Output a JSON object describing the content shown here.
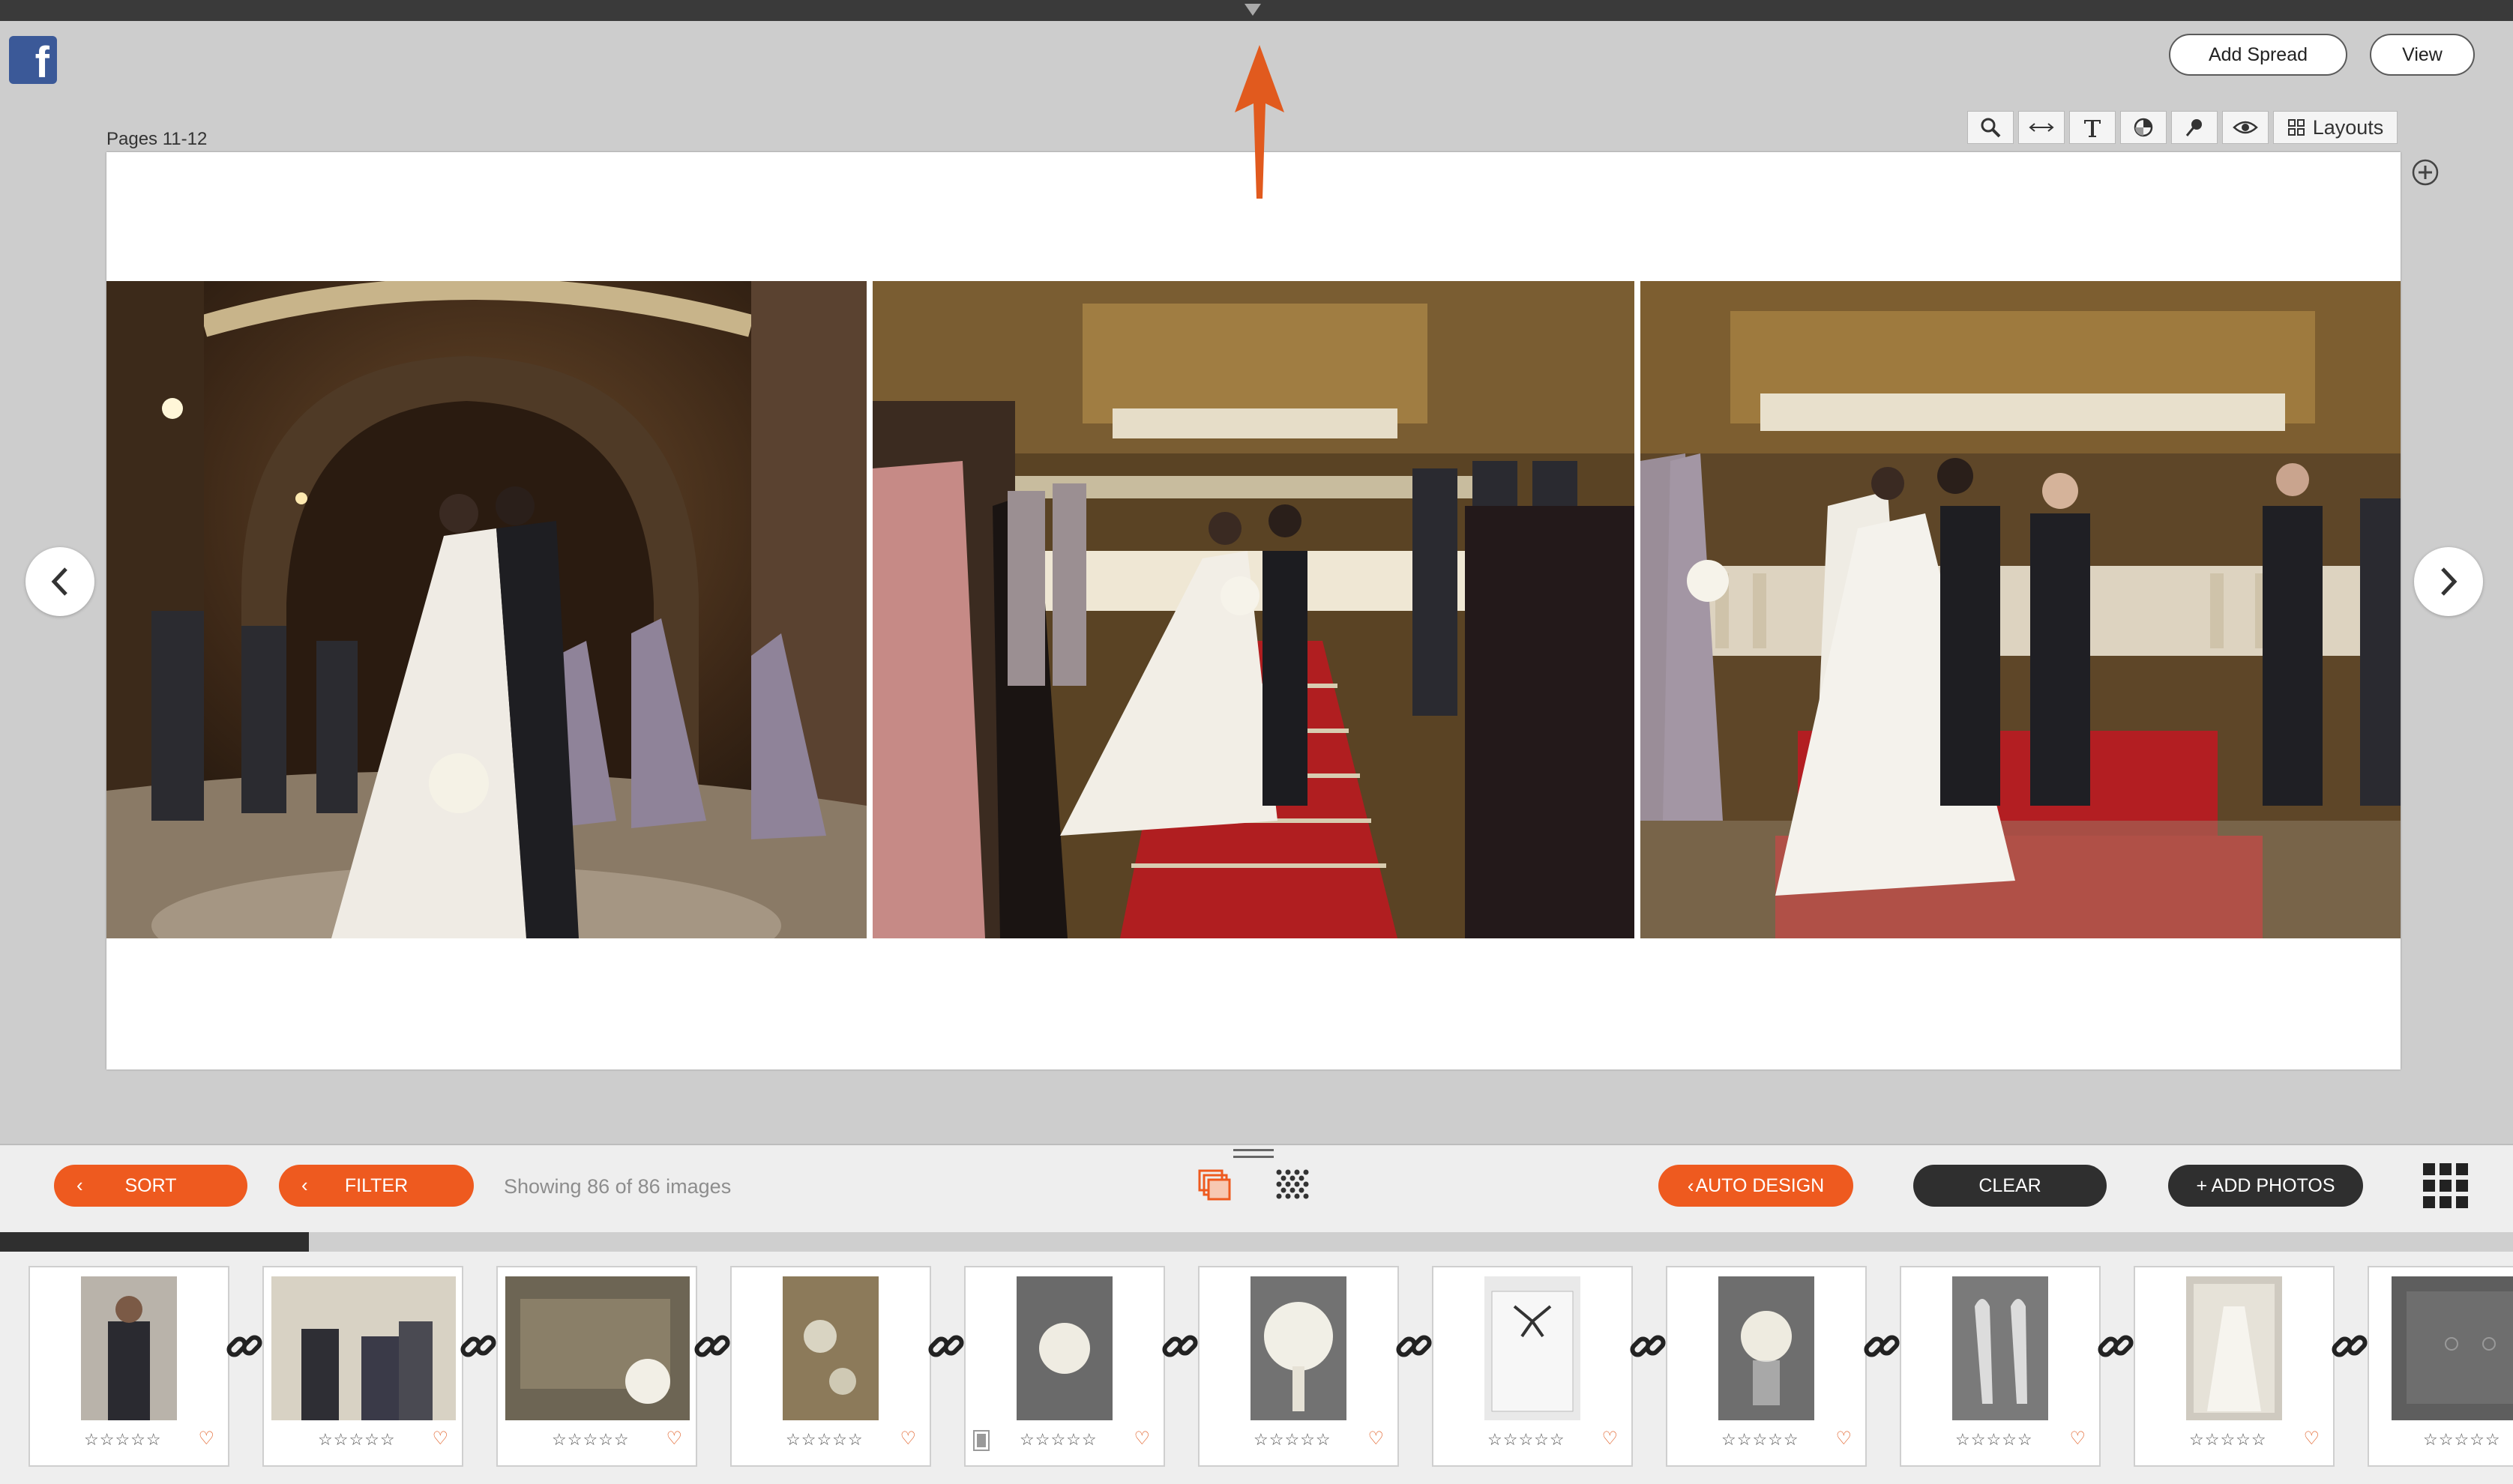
{
  "header": {
    "add_spread_label": "Add Spread",
    "view_label": "View",
    "facebook_logo": "f",
    "pages_label": "Pages 11-12",
    "layouts_label": "Layouts"
  },
  "toolbar_icons": [
    "zoom-icon",
    "resize-icon",
    "text-icon",
    "fill-icon",
    "pin-icon",
    "preview-eye-icon"
  ],
  "spread": {
    "photos": [
      "ceremony-kiss-arch",
      "ceremony-aisle-walk",
      "ceremony-altar-kiss"
    ]
  },
  "panel": {
    "sort_label": "SORT",
    "filter_label": "FILTER",
    "showing_text": "Showing 86 of 86 images",
    "auto_design_label": "AUTO DESIGN",
    "clear_label": "CLEAR",
    "add_photos_label": "+ ADD PHOTOS",
    "progress": 0.123
  },
  "thumbnails": [
    {
      "subject": "groom-portrait",
      "stars": "☆☆☆☆☆",
      "heart": "♡"
    },
    {
      "subject": "groom-with-family",
      "stars": "☆☆☆☆☆",
      "heart": "♡"
    },
    {
      "subject": "rings-tray",
      "stars": "☆☆☆☆☆",
      "heart": "♡"
    },
    {
      "subject": "boutonniere-on-wood",
      "stars": "☆☆☆☆☆",
      "heart": "♡"
    },
    {
      "subject": "bouquet-dark",
      "stars": "☆☆☆☆☆",
      "heart": "♡"
    },
    {
      "subject": "bouquet-white",
      "stars": "☆☆☆☆☆",
      "heart": "♡"
    },
    {
      "subject": "invitation-card",
      "stars": "☆☆☆☆☆",
      "heart": "♡"
    },
    {
      "subject": "bouquet-vase",
      "stars": "☆☆☆☆☆",
      "heart": "♡"
    },
    {
      "subject": "bridal-shoes",
      "stars": "☆☆☆☆☆",
      "heart": "♡"
    },
    {
      "subject": "dress-on-window",
      "stars": "☆☆☆☆☆",
      "heart": "♡"
    },
    {
      "subject": "stationery-detail",
      "stars": "☆☆☆☆☆",
      "heart": ""
    }
  ],
  "colors": {
    "accent": "#ee5a1f",
    "dark_button": "#2f2f2f",
    "facebook": "#3b5998"
  }
}
